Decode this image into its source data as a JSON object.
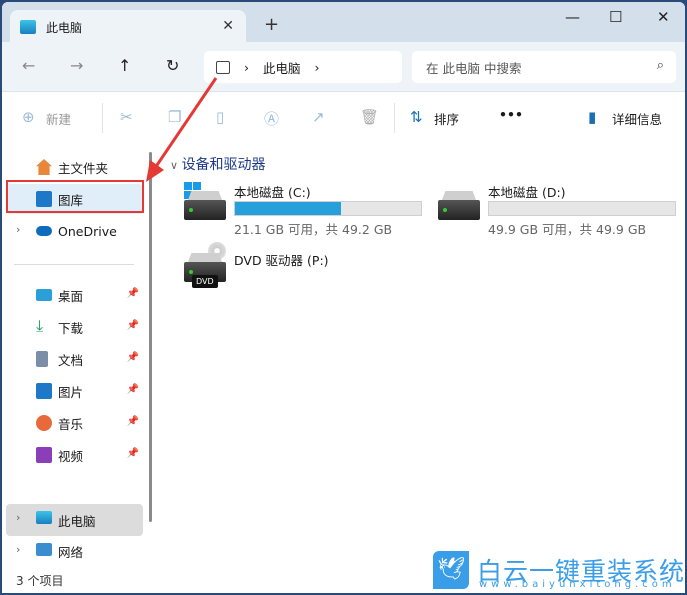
{
  "tab": {
    "title": "此电脑",
    "close": "✕",
    "new": "+"
  },
  "window": {
    "minimize": "—",
    "maximize": "☐",
    "close": "✕"
  },
  "nav": {
    "back": "←",
    "forward": "→",
    "up": "↑",
    "refresh": "↻"
  },
  "address": {
    "crumbs": [
      "此电脑"
    ],
    "sep": "›"
  },
  "search": {
    "placeholder": "在 此电脑 中搜索"
  },
  "toolbar": {
    "new": "新建",
    "sort": "排序",
    "more": "•••",
    "details": "详细信息"
  },
  "sidebar": {
    "items": [
      {
        "label": "主文件夹",
        "icon": "home-icon"
      },
      {
        "label": "图库",
        "icon": "gallery-icon"
      },
      {
        "label": "OneDrive",
        "icon": "cloud-icon"
      },
      {
        "label": "桌面",
        "icon": "desktop-icon"
      },
      {
        "label": "下载",
        "icon": "download-icon"
      },
      {
        "label": "文档",
        "icon": "document-icon"
      },
      {
        "label": "图片",
        "icon": "pictures-icon"
      },
      {
        "label": "音乐",
        "icon": "music-icon"
      },
      {
        "label": "视频",
        "icon": "video-icon"
      },
      {
        "label": "此电脑",
        "icon": "computer-icon"
      },
      {
        "label": "网络",
        "icon": "network-icon"
      }
    ]
  },
  "content": {
    "section": "设备和驱动器",
    "drives": [
      {
        "name": "本地磁盘 (C:)",
        "info": "21.1 GB 可用，共 49.2 GB",
        "used_percent": 57
      },
      {
        "name": "本地磁盘 (D:)",
        "info": "49.9 GB 可用，共 49.9 GB",
        "used_percent": 0
      },
      {
        "name": "DVD 驱动器 (P:)",
        "badge": "DVD"
      }
    ]
  },
  "status": {
    "count": "3 个项目"
  },
  "watermark": {
    "title": "白云一键重装系统",
    "url": "www.baiyunxitong.com"
  },
  "colors": {
    "accent": "#26a0da",
    "highlight": "#e53935"
  }
}
